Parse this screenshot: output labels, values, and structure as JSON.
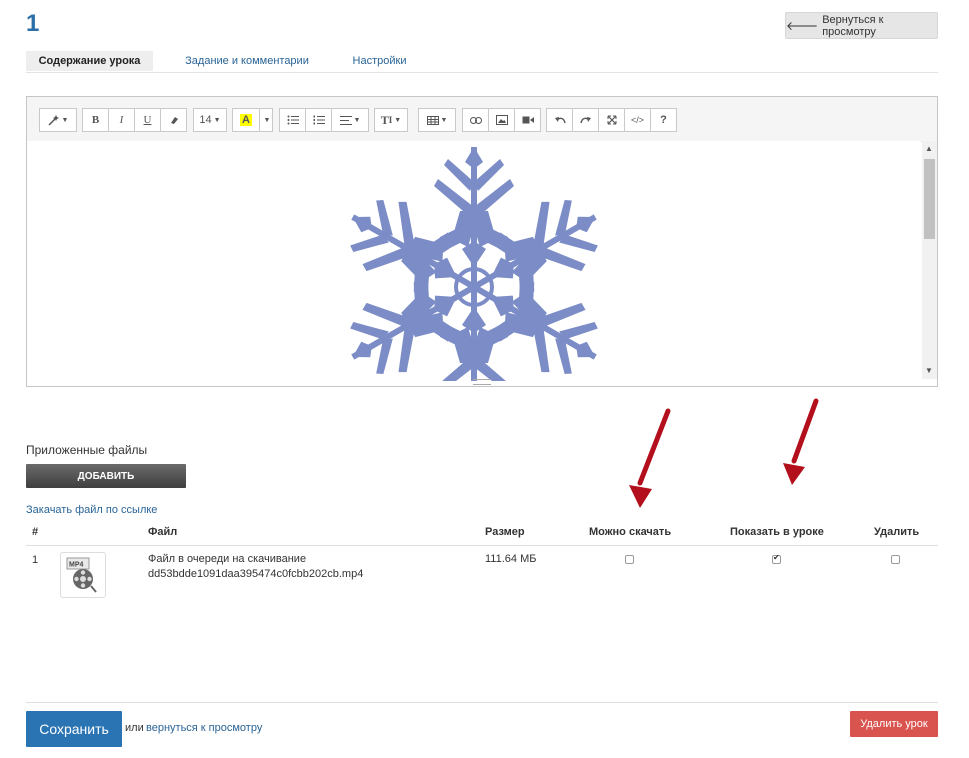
{
  "header": {
    "lesson_number": "1",
    "back_button_label": "Вернуться к просмотру"
  },
  "tabs": [
    {
      "label": "Содержание урока",
      "active": true
    },
    {
      "label": "Задание и комментарии",
      "active": false
    },
    {
      "label": "Настройки",
      "active": false
    }
  ],
  "editor": {
    "toolbar": {
      "font_size": "14",
      "buttons": [
        "magic-icon",
        "bold-icon",
        "italic-icon",
        "underline-icon",
        "eraser-icon",
        "font-size",
        "font-color-icon",
        "unordered-list-icon",
        "ordered-list-icon",
        "align-icon",
        "text-height-icon",
        "table-icon",
        "link-icon",
        "picture-icon",
        "video-icon",
        "undo-icon",
        "redo-icon",
        "fullscreen-icon",
        "code-view-icon",
        "help-icon"
      ],
      "bold": "B",
      "italic": "I",
      "underline": "U",
      "color": "A",
      "text_height": "T",
      "help": "?"
    },
    "content_image": "snowflake-image"
  },
  "attachments": {
    "title": "Приложенные файлы",
    "add_button_label": "ДОБАВИТЬ",
    "download_by_link": "Закачать файл по ссылке",
    "columns": [
      "#",
      "Файл",
      "Размер",
      "Можно скачать",
      "Показать в уроке",
      "Удалить"
    ],
    "rows": [
      {
        "index": "1",
        "thumb_label": "MP4",
        "status": "Файл в очереди на скачивание",
        "file_name": "dd53bdde1091daa395474c0fcbb202cb.mp4",
        "size": "111.64 МБ",
        "can_download": false,
        "show_in_lesson": true,
        "delete": false
      }
    ]
  },
  "footer": {
    "save_label": "Сохранить",
    "or_text": "или",
    "back_link": "вернуться к просмотру",
    "delete_label": "Удалить урок"
  },
  "colors": {
    "accent": "#2a74b3",
    "danger": "#d9534f",
    "snowflake": "#7b8cc6",
    "annotation_arrow": "#b30f1d"
  }
}
